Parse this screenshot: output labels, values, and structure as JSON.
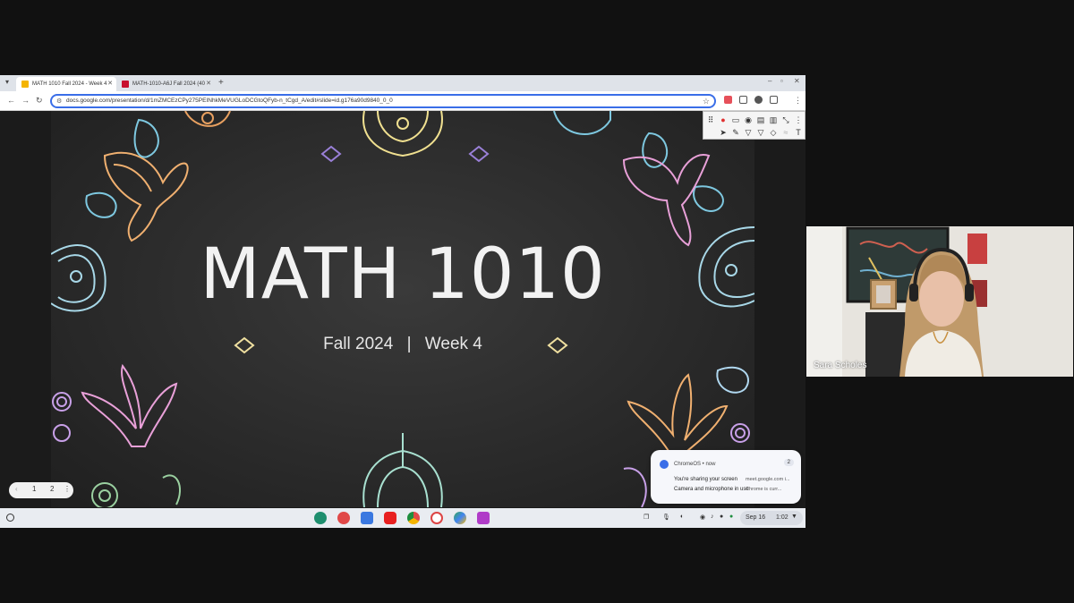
{
  "browser": {
    "tabs": [
      {
        "title": "MATH 1010 Fall 2024 - Week 4",
        "active": true,
        "icon": "google-slides-icon"
      },
      {
        "title": "MATH-1010-A6J Fall 2024 (40",
        "active": false,
        "icon": "university-logo-icon"
      }
    ],
    "url": "docs.google.com/presentation/d/1mZMCEzCPy275PEINhkMeVUGLoDCGtoQFyb-n_tCgd_A/edit#slide=id.g176a90d9840_0_0"
  },
  "slide": {
    "title": "MATH 1010",
    "subtitle_left": "Fall 2024",
    "separator": "|",
    "subtitle_right": "Week 4"
  },
  "slide_nav": {
    "current": "1",
    "next": "2"
  },
  "notification": {
    "app": "ChromeOS • now",
    "count": "2",
    "line1": "You're sharing your screen",
    "line1_detail": "meet.google.com i...",
    "line2": "Camera and microphone in use",
    "line2_detail": "Chrome is curr..."
  },
  "shelf": {
    "date": "Sep 16",
    "time": "1:02"
  },
  "video": {
    "participant_name": "Sara Scholes"
  },
  "colors": {
    "accent": "#3a6ee8",
    "chalkboard": "#2b2b2b"
  }
}
